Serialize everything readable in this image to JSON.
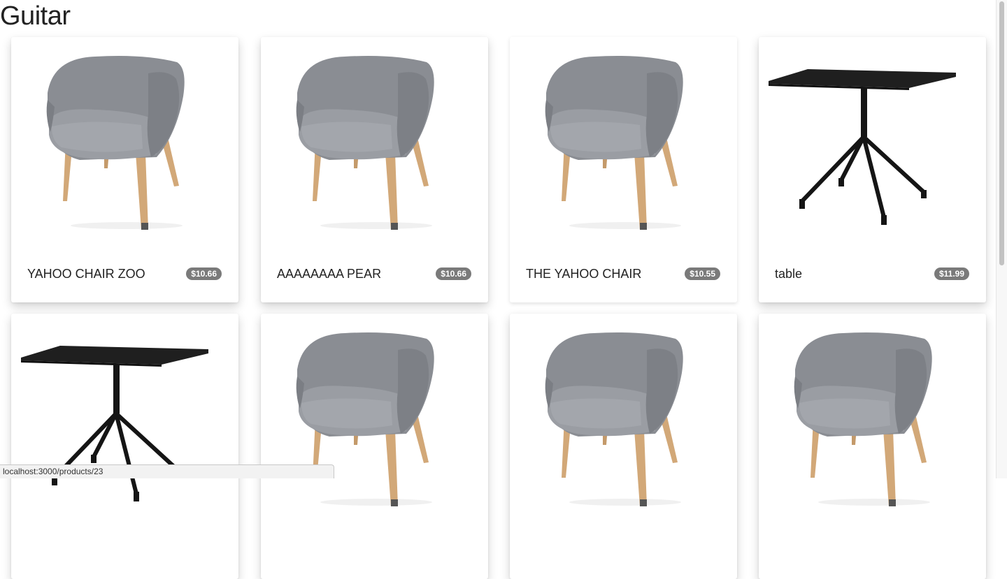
{
  "page": {
    "title": "Guitar"
  },
  "products": [
    {
      "name": "YAHOO CHAIR ZOO",
      "price": "$10.66",
      "image": "armchair"
    },
    {
      "name": "AAAAAAAA PEAR",
      "price": "$10.66",
      "image": "armchair"
    },
    {
      "name": "THE YAHOO CHAIR",
      "price": "$10.55",
      "image": "armchair"
    },
    {
      "name": "table",
      "price": "$11.99",
      "image": "table"
    },
    {
      "name": "",
      "price": "",
      "image": "table"
    },
    {
      "name": "",
      "price": "",
      "image": "armchair"
    },
    {
      "name": "",
      "price": "",
      "image": "armchair"
    },
    {
      "name": "",
      "price": "",
      "image": "armchair"
    }
  ],
  "status_bar": {
    "url": "localhost:3000/products/23"
  },
  "colors": {
    "badge": "#7a7a7a",
    "chair_fabric": "#8a8d93",
    "chair_legs": "#d2a878",
    "table": "#1f1f1f"
  }
}
